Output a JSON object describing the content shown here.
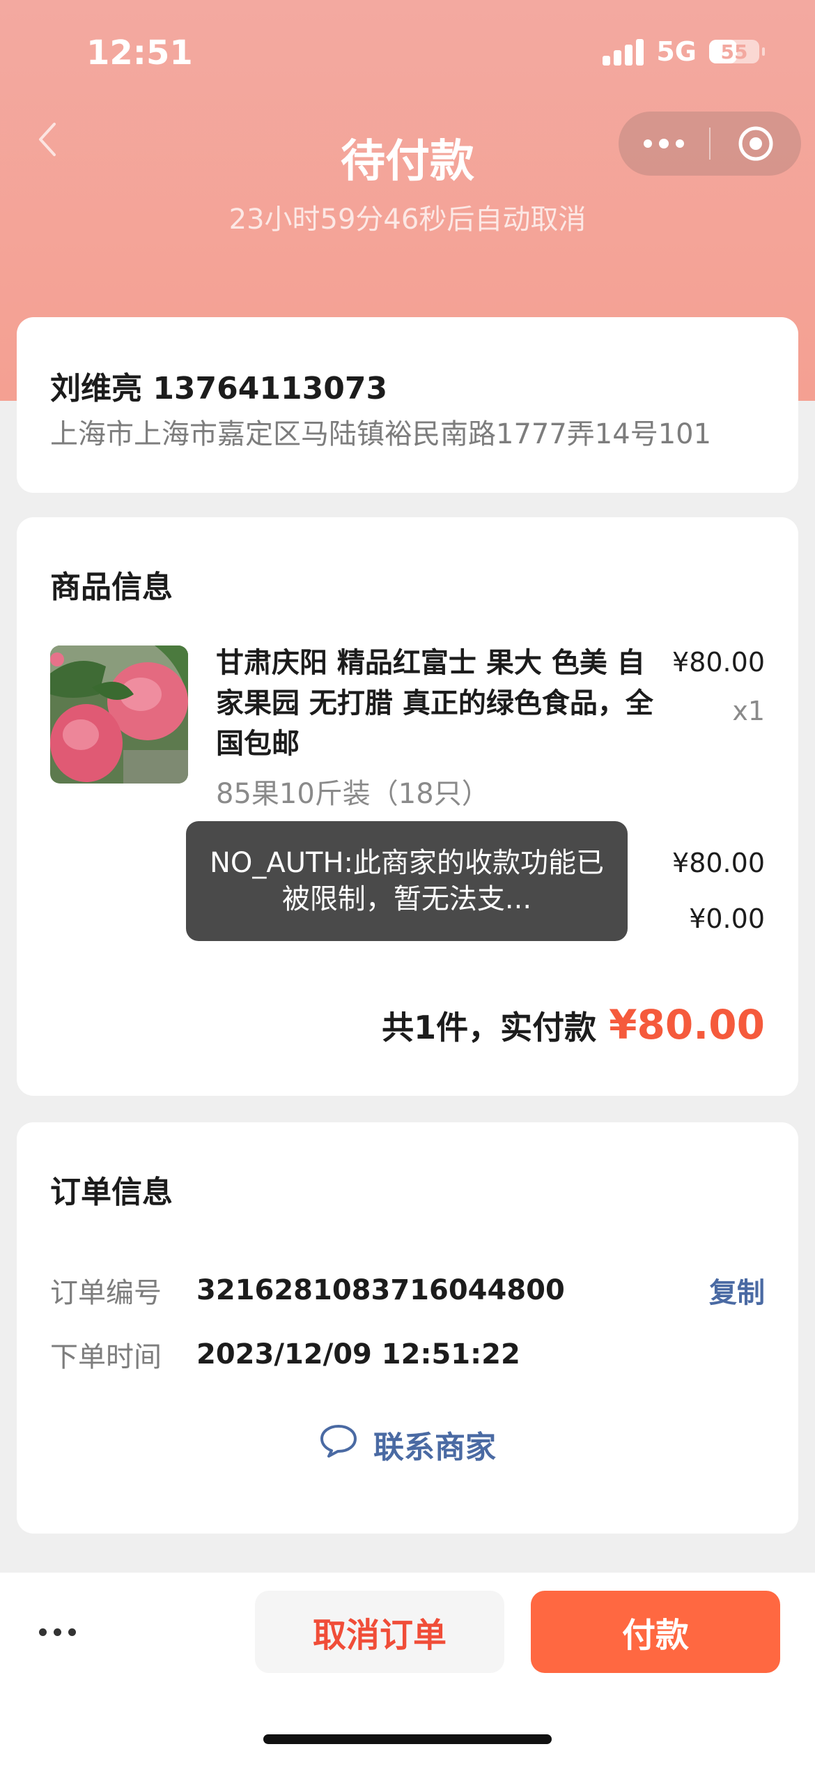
{
  "status_bar": {
    "time": "12:51",
    "network": "5G",
    "battery": "55",
    "battery_level": 0.55
  },
  "nav": {
    "title": "待付款",
    "subtitle": "23小时59分46秒后自动取消"
  },
  "address": {
    "name_phone": "刘维亮 13764113073",
    "detail": "上海市上海市嘉定区马陆镇裕民南路1777弄14号101"
  },
  "goods": {
    "section_title": "商品信息",
    "name": "甘肃庆阳 精品红富士 果大 色美 自家果园 无打腊 真正的绿色食品，全国包邮",
    "price": "¥80.00",
    "quantity": "x1",
    "spec": "85果10斤装（18只）",
    "subtotal": "¥80.00",
    "shipping": "¥0.00",
    "total_label": "共1件，实付款",
    "total_amount": "¥80.00"
  },
  "toast": {
    "message": "NO_AUTH:此商家的收款功能已被限制，暂无法支..."
  },
  "order": {
    "section_title": "订单信息",
    "number_label": "订单编号",
    "number_value": "3216281083716044800",
    "copy_label": "复制",
    "time_label": "下单时间",
    "time_value": "2023/12/09 12:51:22",
    "contact_label": "联系商家"
  },
  "actions": {
    "cancel_label": "取消订单",
    "pay_label": "付款"
  },
  "colors": {
    "header": "#f3a9a0",
    "accent": "#ff6841",
    "price_red": "#f55a3c",
    "link_blue": "#4a6aa3"
  }
}
